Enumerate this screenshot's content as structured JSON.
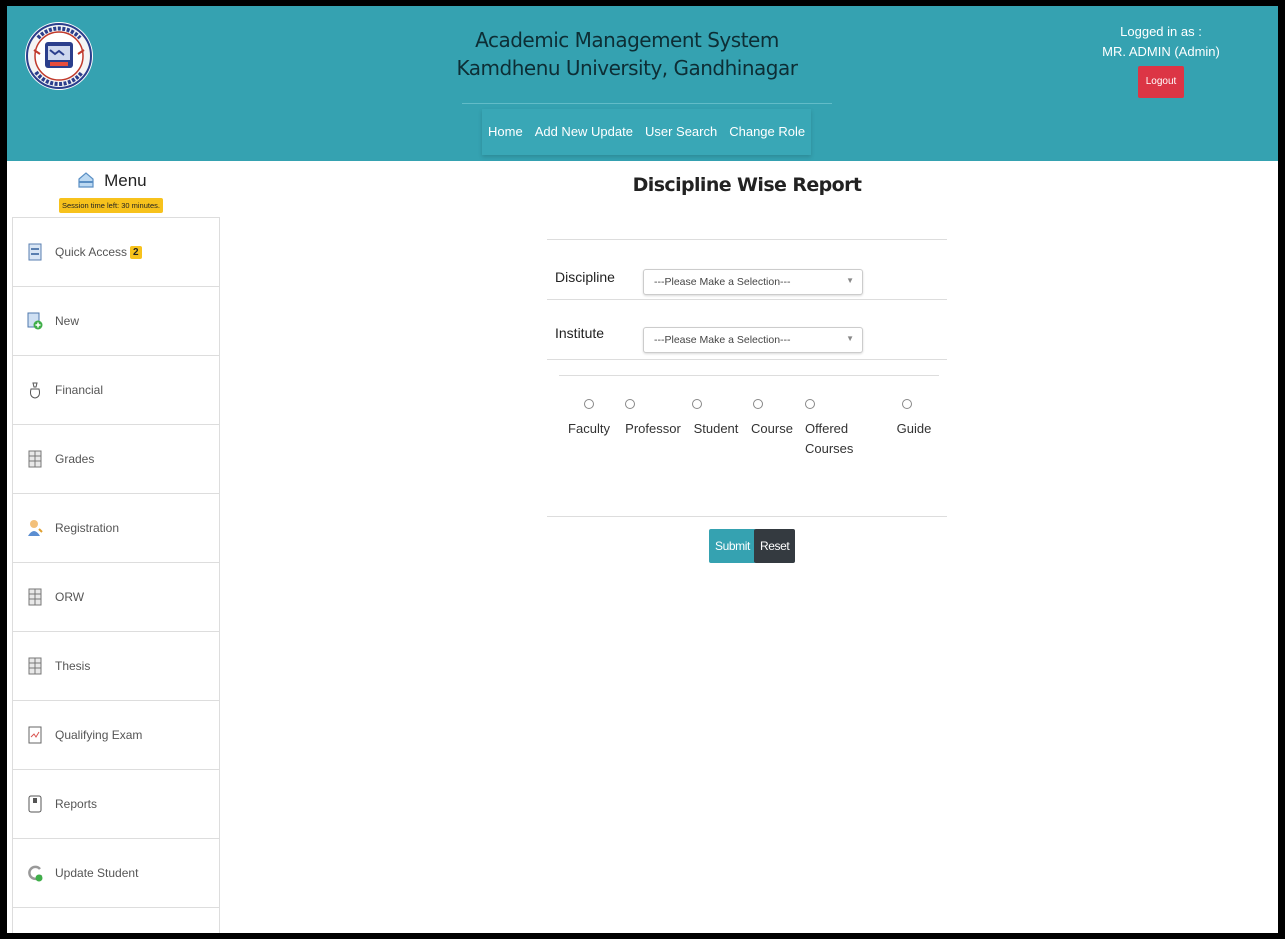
{
  "header": {
    "title_line1": "Academic Management System",
    "title_line2": "Kamdhenu University, Gandhinagar",
    "logo_icon": "university-seal-icon",
    "nav": [
      "Home",
      "Add New Update",
      "User Search",
      "Change Role"
    ],
    "logged_in_label": "Logged in as :",
    "user_name": "MR. ADMIN (Admin)",
    "logout_label": "Logout"
  },
  "sidebar": {
    "menu_title": "Menu",
    "menu_icon": "home-icon",
    "session_text": "Session time left: 30 minutes.",
    "items": [
      {
        "label": "Quick Access",
        "icon": "document-icon",
        "badge": "2"
      },
      {
        "label": "New",
        "icon": "new-file-icon"
      },
      {
        "label": "Financial",
        "icon": "money-bag-icon"
      },
      {
        "label": "Grades",
        "icon": "grid-icon"
      },
      {
        "label": "Registration",
        "icon": "user-icon"
      },
      {
        "label": "ORW",
        "icon": "grid-icon"
      },
      {
        "label": "Thesis",
        "icon": "grid-icon"
      },
      {
        "label": "Qualifying Exam",
        "icon": "exam-icon"
      },
      {
        "label": "Reports",
        "icon": "report-icon"
      },
      {
        "label": "Update Student",
        "icon": "refresh-icon"
      }
    ]
  },
  "main": {
    "page_title": "Discipline Wise Report",
    "discipline_label": "Discipline",
    "discipline_value": "---Please Make a Selection---",
    "institute_label": "Institute",
    "institute_value": "---Please Make a Selection---",
    "radio_options": [
      "Faculty",
      "Professor",
      "Student",
      "Course",
      "Offered Courses",
      "Guide"
    ],
    "submit_label": "Submit",
    "reset_label": "Reset"
  },
  "colors": {
    "header_bg": "#35a2b1",
    "logout_bg": "#dc3545",
    "badge_bg": "#f7c21c",
    "reset_bg": "#343a40"
  }
}
